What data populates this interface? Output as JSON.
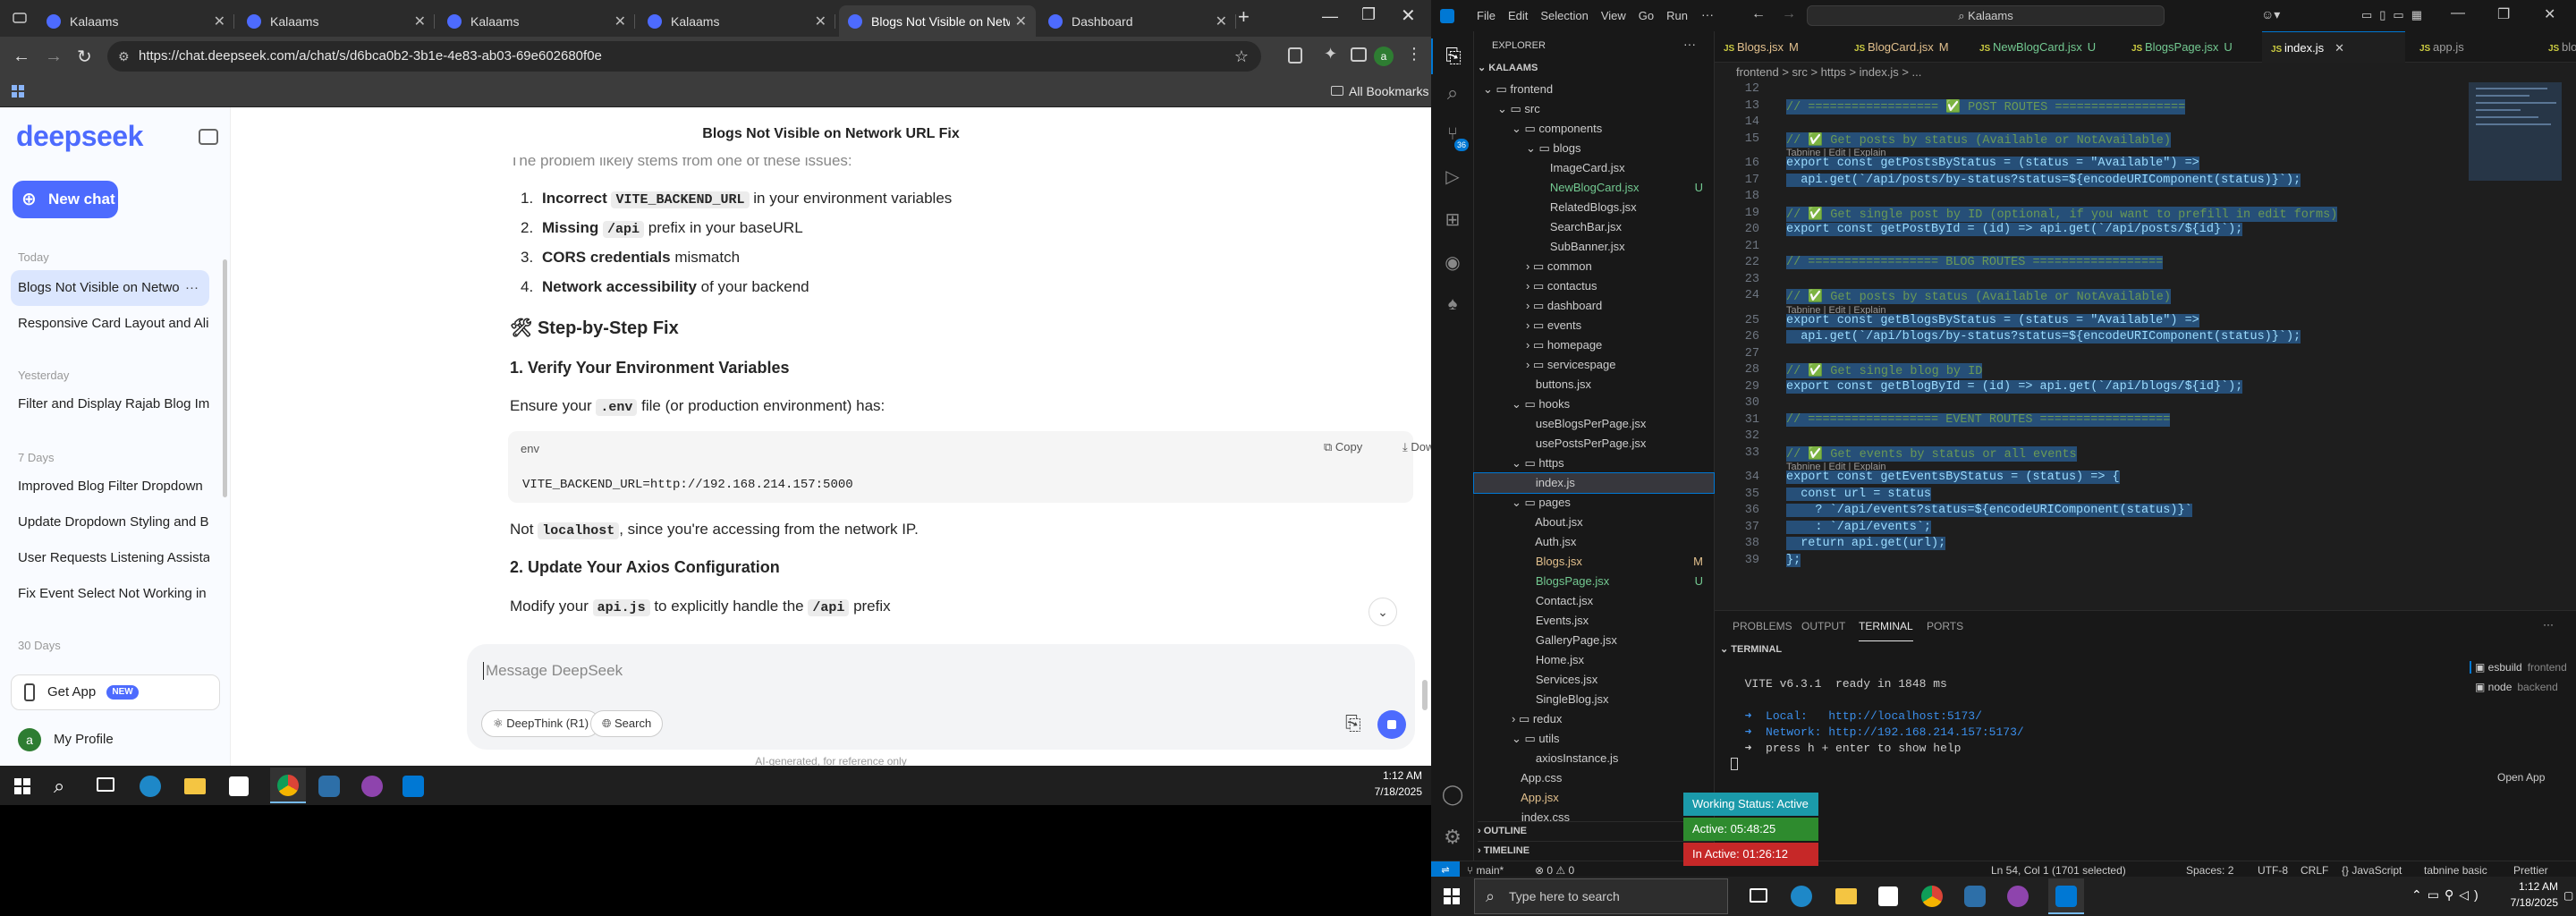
{
  "chrome": {
    "tabs": [
      {
        "label": "Kalaams",
        "active": false
      },
      {
        "label": "Kalaams",
        "active": false
      },
      {
        "label": "Kalaams",
        "active": false
      },
      {
        "label": "Kalaams",
        "active": false
      },
      {
        "label": "Blogs Not Visible on Netwo",
        "active": true
      },
      {
        "label": "Dashboard",
        "active": false
      }
    ],
    "url": "https://chat.deepseek.com/a/chat/s/d6bca0b2-3b1e-4e83-ab03-69e602680f0e",
    "bookmarks_label": "All Bookmarks"
  },
  "deepseek": {
    "logo": "deepseek",
    "new_chat": "New chat",
    "groups": {
      "today": "Today",
      "yesterday": "Yesterday",
      "week": "7 Days",
      "month": "30 Days"
    },
    "chats": {
      "today": [
        "Blogs Not Visible on Netwo",
        "Responsive Card Layout and Alig"
      ],
      "yesterday": [
        "Filter and Display Rajab Blog Ima"
      ],
      "week": [
        "Improved Blog Filter Dropdown",
        "Update Dropdown Styling and B",
        "User Requests Listening Assistan",
        "Fix Event Select Not Working in"
      ]
    },
    "get_app": "Get App",
    "new_badge": "NEW",
    "profile": "My Profile",
    "profile_initial": "a",
    "chat_title": "Blogs Not Visible on Network URL Fix",
    "intro": "The problem likely stems from one of these issues:",
    "causes": [
      {
        "n": "1.",
        "b": "Incorrect ",
        "c": "VITE_BACKEND_URL",
        "t": " in your environment variables"
      },
      {
        "n": "2.",
        "b": "Missing ",
        "c": "/api",
        "t": " prefix in your baseURL"
      },
      {
        "n": "3.",
        "b": "CORS credentials",
        "c": "",
        "t": " mismatch"
      },
      {
        "n": "4.",
        "b": "Network accessibility",
        "c": "",
        "t": " of your backend"
      }
    ],
    "step_heading": "🛠 Step-by-Step Fix",
    "h1": "1. Verify Your Environment Variables",
    "ensure_pre": "Ensure your ",
    "ensure_code": ".env",
    "ensure_post": " file (or production environment) has:",
    "code_lang": "env",
    "copy": "Copy",
    "download": "Download",
    "code_line": "VITE_BACKEND_URL=http://192.168.214.157:5000",
    "not_pre": "Not ",
    "not_code": "localhost",
    "not_post": ", since you're accessing from the network IP.",
    "h2": "2. Update Your Axios Configuration",
    "modify_pre": "Modify your ",
    "modify_code1": "api.js",
    "modify_mid": " to explicitly handle the ",
    "modify_code2": "/api",
    "modify_post": " prefix",
    "input_placeholder": "Message DeepSeek",
    "deepthink": "DeepThink (R1)",
    "search": "Search",
    "footer": "AI-generated, for reference only"
  },
  "taskbar_left": {
    "time": "1:12 AM",
    "date": "7/18/2025"
  },
  "vscode": {
    "menu": [
      "File",
      "Edit",
      "Selection",
      "View",
      "Go",
      "Run"
    ],
    "search": "Kalaams",
    "explorer_title": "EXPLORER",
    "workspace": "KALAAMS",
    "tree": [
      {
        "label": "frontend",
        "depth": 0,
        "kind": "folder-open",
        "status": ""
      },
      {
        "label": "src",
        "depth": 1,
        "kind": "folder-open",
        "status": ""
      },
      {
        "label": "components",
        "depth": 2,
        "kind": "folder-open",
        "status": ""
      },
      {
        "label": "blogs",
        "depth": 3,
        "kind": "folder-open",
        "status": ""
      },
      {
        "label": "ImageCard.jsx",
        "depth": 4,
        "kind": "file",
        "status": ""
      },
      {
        "label": "NewBlogCard.jsx",
        "depth": 4,
        "kind": "file",
        "status": "U"
      },
      {
        "label": "RelatedBlogs.jsx",
        "depth": 4,
        "kind": "file",
        "status": ""
      },
      {
        "label": "SearchBar.jsx",
        "depth": 4,
        "kind": "file",
        "status": ""
      },
      {
        "label": "SubBanner.jsx",
        "depth": 4,
        "kind": "file",
        "status": ""
      },
      {
        "label": "common",
        "depth": 3,
        "kind": "folder",
        "status": ""
      },
      {
        "label": "contactus",
        "depth": 3,
        "kind": "folder",
        "status": ""
      },
      {
        "label": "dashboard",
        "depth": 3,
        "kind": "folder",
        "status": ""
      },
      {
        "label": "events",
        "depth": 3,
        "kind": "folder",
        "status": ""
      },
      {
        "label": "homepage",
        "depth": 3,
        "kind": "folder",
        "status": ""
      },
      {
        "label": "servicespage",
        "depth": 3,
        "kind": "folder",
        "status": ""
      },
      {
        "label": "buttons.jsx",
        "depth": 3,
        "kind": "file",
        "status": ""
      },
      {
        "label": "hooks",
        "depth": 2,
        "kind": "folder-open",
        "status": ""
      },
      {
        "label": "useBlogsPerPage.jsx",
        "depth": 3,
        "kind": "file",
        "status": ""
      },
      {
        "label": "usePostsPerPage.jsx",
        "depth": 3,
        "kind": "file",
        "status": ""
      },
      {
        "label": "https",
        "depth": 2,
        "kind": "folder-open",
        "status": ""
      },
      {
        "label": "index.js",
        "depth": 3,
        "kind": "file-sel",
        "status": ""
      },
      {
        "label": "pages",
        "depth": 2,
        "kind": "folder-open",
        "status": ""
      },
      {
        "label": "About.jsx",
        "depth": 3,
        "kind": "file",
        "status": ""
      },
      {
        "label": "Auth.jsx",
        "depth": 3,
        "kind": "file",
        "status": ""
      },
      {
        "label": "Blogs.jsx",
        "depth": 3,
        "kind": "file",
        "status": "M"
      },
      {
        "label": "BlogsPage.jsx",
        "depth": 3,
        "kind": "file",
        "status": "U"
      },
      {
        "label": "Contact.jsx",
        "depth": 3,
        "kind": "file",
        "status": ""
      },
      {
        "label": "Events.jsx",
        "depth": 3,
        "kind": "file",
        "status": ""
      },
      {
        "label": "GalleryPage.jsx",
        "depth": 3,
        "kind": "file",
        "status": ""
      },
      {
        "label": "Home.jsx",
        "depth": 3,
        "kind": "file",
        "status": ""
      },
      {
        "label": "Services.jsx",
        "depth": 3,
        "kind": "file",
        "status": ""
      },
      {
        "label": "SingleBlog.jsx",
        "depth": 3,
        "kind": "file",
        "status": ""
      },
      {
        "label": "redux",
        "depth": 2,
        "kind": "folder",
        "status": ""
      },
      {
        "label": "utils",
        "depth": 2,
        "kind": "folder-open",
        "status": ""
      },
      {
        "label": "axiosInstance.js",
        "depth": 3,
        "kind": "file",
        "status": ""
      },
      {
        "label": "App.css",
        "depth": 2,
        "kind": "file",
        "status": ""
      },
      {
        "label": "App.jsx",
        "depth": 2,
        "kind": "file",
        "status": "M"
      },
      {
        "label": "index.css",
        "depth": 2,
        "kind": "file",
        "status": ""
      }
    ],
    "outline": "OUTLINE",
    "timeline": "TIMELINE",
    "tabs": [
      {
        "label": "Blogs.jsx",
        "status": "M"
      },
      {
        "label": "BlogCard.jsx",
        "status": "M"
      },
      {
        "label": "NewBlogCard.jsx",
        "status": "U"
      },
      {
        "label": "BlogsPage.jsx",
        "status": "U"
      },
      {
        "label": "index.js",
        "status": ""
      },
      {
        "label": "app.js",
        "status": ""
      },
      {
        "label": "blogRoute.js",
        "status": ""
      }
    ],
    "breadcrumb": "frontend  >  src  >  https  >  index.js  >  ...",
    "lens": "Tabnine | Edit | Explain",
    "code_lines": [
      {
        "n": "12",
        "t": ""
      },
      {
        "n": "13",
        "t": "// ================== ✅ POST ROUTES =================="
      },
      {
        "n": "14",
        "t": ""
      },
      {
        "n": "15",
        "t": "// ✅ Get posts by status (Available or NotAvailable)"
      },
      {
        "n": "16",
        "t": "export const getPostsByStatus = (status = \"Available\") =>"
      },
      {
        "n": "17",
        "t": "  api.get(`/api/posts/by-status?status=${encodeURIComponent(status)}`);"
      },
      {
        "n": "18",
        "t": ""
      },
      {
        "n": "19",
        "t": "// ✅ Get single post by ID (optional, if you want to prefill in edit forms)"
      },
      {
        "n": "20",
        "t": "export const getPostById = (id) => api.get(`/api/posts/${id}`);"
      },
      {
        "n": "21",
        "t": ""
      },
      {
        "n": "22",
        "t": "// ================== BLOG ROUTES =================="
      },
      {
        "n": "23",
        "t": ""
      },
      {
        "n": "24",
        "t": "// ✅ Get posts by status (Available or NotAvailable)"
      },
      {
        "n": "25",
        "t": "export const getBlogsByStatus = (status = \"Available\") =>"
      },
      {
        "n": "26",
        "t": "  api.get(`/api/blogs/by-status?status=${encodeURIComponent(status)}`);"
      },
      {
        "n": "27",
        "t": ""
      },
      {
        "n": "28",
        "t": "// ✅ Get single blog by ID"
      },
      {
        "n": "29",
        "t": "export const getBlogById = (id) => api.get(`/api/blogs/${id}`);"
      },
      {
        "n": "30",
        "t": ""
      },
      {
        "n": "31",
        "t": "// ================== EVENT ROUTES =================="
      },
      {
        "n": "32",
        "t": ""
      },
      {
        "n": "33",
        "t": "// ✅ Get events by status or all events"
      },
      {
        "n": "34",
        "t": "export const getEventsByStatus = (status) => {"
      },
      {
        "n": "35",
        "t": "  const url = status"
      },
      {
        "n": "36",
        "t": "    ? `/api/events?status=${encodeURIComponent(status)}`"
      },
      {
        "n": "37",
        "t": "    : `/api/events`;"
      },
      {
        "n": "38",
        "t": "  return api.get(url);"
      },
      {
        "n": "39",
        "t": "};"
      }
    ],
    "panel_tabs": [
      "PROBLEMS",
      "OUTPUT",
      "TERMINAL",
      "PORTS"
    ],
    "terminal_header": "TERMINAL",
    "terminal_lines": [
      "  VITE v6.3.1  ready in 1848 ms",
      "",
      "  ➜  Local:   http://localhost:5173/",
      "  ➜  Network: http://192.168.214.157:5173/",
      "  ➜  press h + enter to show help"
    ],
    "terminals": [
      {
        "label": "esbuild",
        "sub": "frontend"
      },
      {
        "label": "node",
        "sub": "backend"
      }
    ],
    "open_app": "Open App",
    "working_status": "Working Status: Active",
    "active_time": "Active: 05:48:25",
    "inactive_time": "In Active: 01:26:12",
    "status": {
      "branch": "main*",
      "problems": "0 ⚠ 0",
      "position": "Ln 54, Col 1 (1701 selected)",
      "spaces": "Spaces: 2",
      "encoding": "UTF-8",
      "eol": "CRLF",
      "language": "{} JavaScript",
      "tabnine": "tabnine basic",
      "prettier": "Prettier"
    }
  },
  "taskbar_right": {
    "search_placeholder": "Type here to search",
    "time": "1:12 AM",
    "date": "7/18/2025"
  }
}
